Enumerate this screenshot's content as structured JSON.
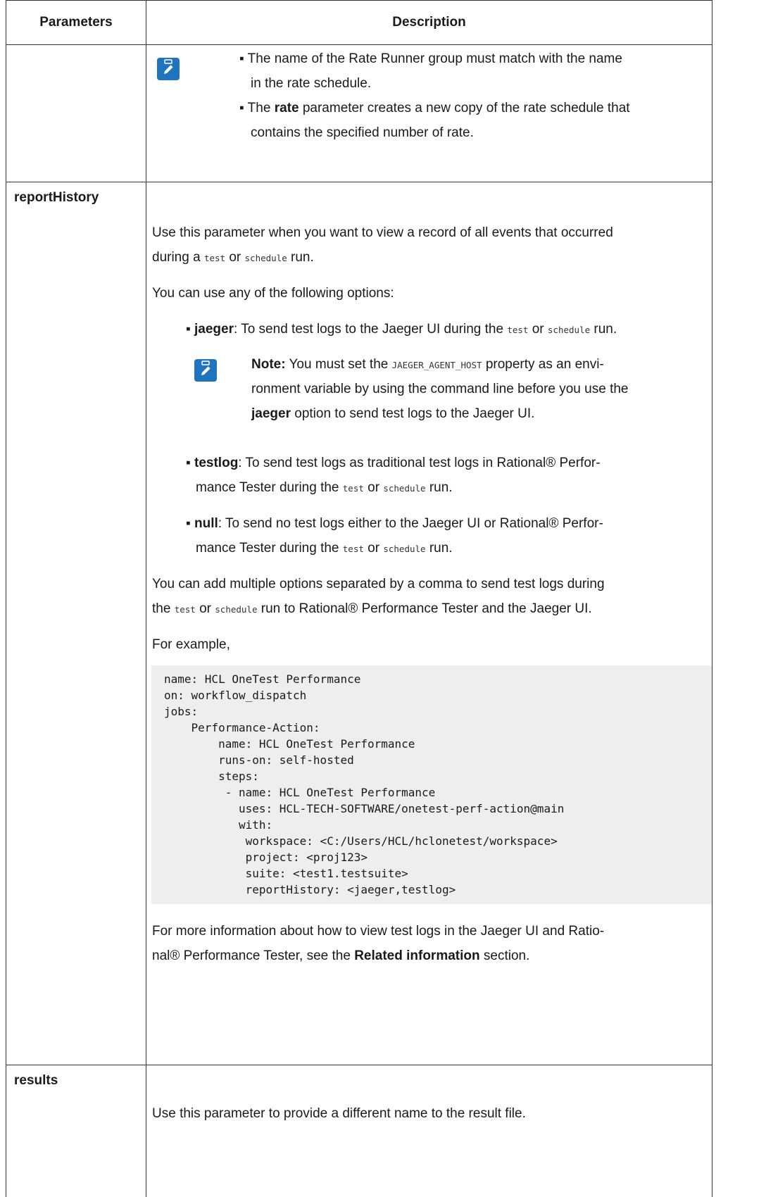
{
  "header": {
    "col1": "Parameters",
    "col2": "Description"
  },
  "row1": {
    "bullet1_line1": "▪ The name of the Rate Runner group must match with the name",
    "bullet1_line2": "in the rate schedule.",
    "bullet2_pre": "▪ The ",
    "bullet2_bold": "rate",
    "bullet2_post": " parameter creates a new copy of the rate schedule that",
    "bullet2_line2": "contains the specified number of rate."
  },
  "row2": {
    "param": "reportHistory",
    "p1_line1": "Use this parameter when you want to view a record of all events that occurred",
    "p1_l2_a": "during a ",
    "p1_l2_code1": "test",
    "p1_l2_b": " or ",
    "p1_l2_code2": "schedule",
    "p1_l2_c": " run.",
    "p2": "You can use any of the following options:",
    "opt1_bullet": "▪ ",
    "opt1_bold": "jaeger",
    "opt1_a": ": To send test logs to the Jaeger UI during the ",
    "opt1_code1": "test",
    "opt1_b": " or ",
    "opt1_code2": "schedule",
    "opt1_c": " run.",
    "note_label": "Note:",
    "note_l1_a": " You must set the ",
    "note_l1_code": "JAEGER_AGENT_HOST",
    "note_l1_b": " property as an envi-",
    "note_l2": "ronment variable by using the command line before you use the",
    "note_l3_bold": "jaeger",
    "note_l3_rest": " option to send test logs to the Jaeger UI.",
    "opt2_bullet": "▪ ",
    "opt2_bold": "testlog",
    "opt2_a": ": To send test logs as traditional test logs in  Rational® Perfor-",
    "opt2_l2_a": "mance Tester during the ",
    "opt2_l2_code1": "test",
    "opt2_l2_b": " or ",
    "opt2_l2_code2": "schedule",
    "opt2_l2_c": " run.",
    "opt3_bullet": "▪ ",
    "opt3_bold": "null",
    "opt3_a": ": To send no test logs either to the Jaeger UI or  Rational® Perfor-",
    "opt3_l2_a": "mance Tester during the ",
    "opt3_l2_code1": "test",
    "opt3_l2_b": " or ",
    "opt3_l2_code2": "schedule",
    "opt3_l2_c": " run.",
    "p3_line1": "You can add multiple options separated by a comma to send test logs during",
    "p3_l2_a": "the ",
    "p3_l2_code1": "test",
    "p3_l2_b": " or ",
    "p3_l2_code2": "schedule",
    "p3_l2_c": " run to  Rational® Performance Tester and the Jaeger UI.",
    "p4": "For example,",
    "code_lines": [
      "name: HCL OneTest Performance",
      "on: workflow_dispatch",
      "jobs:",
      "    Performance-Action:",
      "        name: HCL OneTest Performance",
      "        runs-on: self-hosted",
      "        steps:",
      "         - name: HCL OneTest Performance",
      "           uses: HCL-TECH-SOFTWARE/onetest-perf-action@main",
      "           with:",
      "            workspace: <C:/Users/HCL/hclonetest/workspace>",
      "            project: <proj123>",
      "            suite: <test1.testsuite>",
      "            reportHistory: <jaeger,testlog>"
    ],
    "p5_line1": "For more information about how to view test logs in the Jaeger UI and  Ratio-",
    "p5_l2_a": "nal® Performance Tester, see the ",
    "p5_l2_bold": "Related information",
    "p5_l2_b": " section."
  },
  "row3": {
    "param": "results",
    "p1": "Use this parameter to provide a different name to the result file."
  }
}
